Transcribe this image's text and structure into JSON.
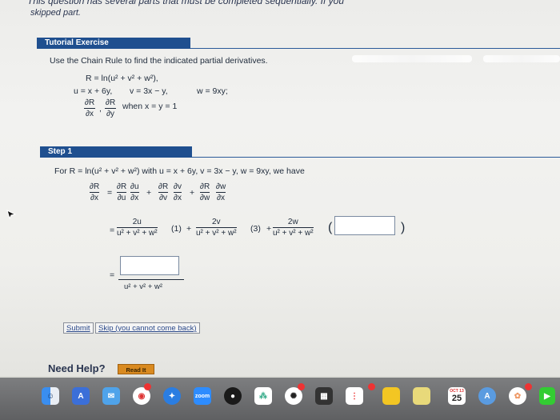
{
  "header": {
    "top_cut_text": "This question has several parts that must be completed sequentially. If you",
    "status_text": "skipped part."
  },
  "tutorial": {
    "header_label": "Tutorial Exercise",
    "instruction": "Use the Chain Rule to find the indicated partial derivatives.",
    "eq1": "R = ln(u² + v² + w²),",
    "eq2a": "u = x + 6y,",
    "eq2b": "v = 3x − y,",
    "eq2c": "w = 9xy;",
    "targets_num1": "∂R",
    "targets_den1": "∂x",
    "targets_sep": ",",
    "targets_num2": "∂R",
    "targets_den2": "∂y",
    "condition": "when x = y = 1"
  },
  "step": {
    "header_label": "Step 1",
    "intro": "For  R = ln(u² + v² + w²)  with  u = x + 6y,  v = 3x − y,  w = 9xy,  we have",
    "lhs_num": "∂R",
    "lhs_den": "∂x",
    "eq": "=",
    "t1a_num": "∂R",
    "t1a_den": "∂u",
    "t1b_num": "∂u",
    "t1b_den": "∂x",
    "plus": "+",
    "t2a_num": "∂R",
    "t2a_den": "∂v",
    "t2b_num": "∂v",
    "t2b_den": "∂x",
    "t3a_num": "∂R",
    "t3a_den": "∂w",
    "t3b_num": "∂w",
    "t3b_den": "∂x",
    "f1_num": "2u",
    "f2_num": "2v",
    "f3_num": "2w",
    "denom": "u² + v² + w²",
    "m1": "(1)",
    "m2": "(3)",
    "open_paren": "(",
    "close_paren": ")",
    "answer1_value": "",
    "answer2_value": ""
  },
  "buttons": {
    "submit": "Submit",
    "skip": "Skip (you cannot come back)"
  },
  "help": {
    "label": "Need Help?",
    "read_it": "Read It"
  },
  "dock": {
    "icons": [
      "finder-icon",
      "translate-icon",
      "mail-icon",
      "chrome-icon",
      "safari-icon",
      "zoom-icon",
      "screen-icon",
      "slack-icon",
      "gpt-icon",
      "calculator-icon",
      "notes-icon",
      "sticky-icon",
      "calendar-icon",
      "maps-icon",
      "photos-icon",
      "facetime-icon"
    ],
    "zoom_label": "zoom",
    "calendar_month": "OCT 13",
    "calendar_day": "25"
  }
}
